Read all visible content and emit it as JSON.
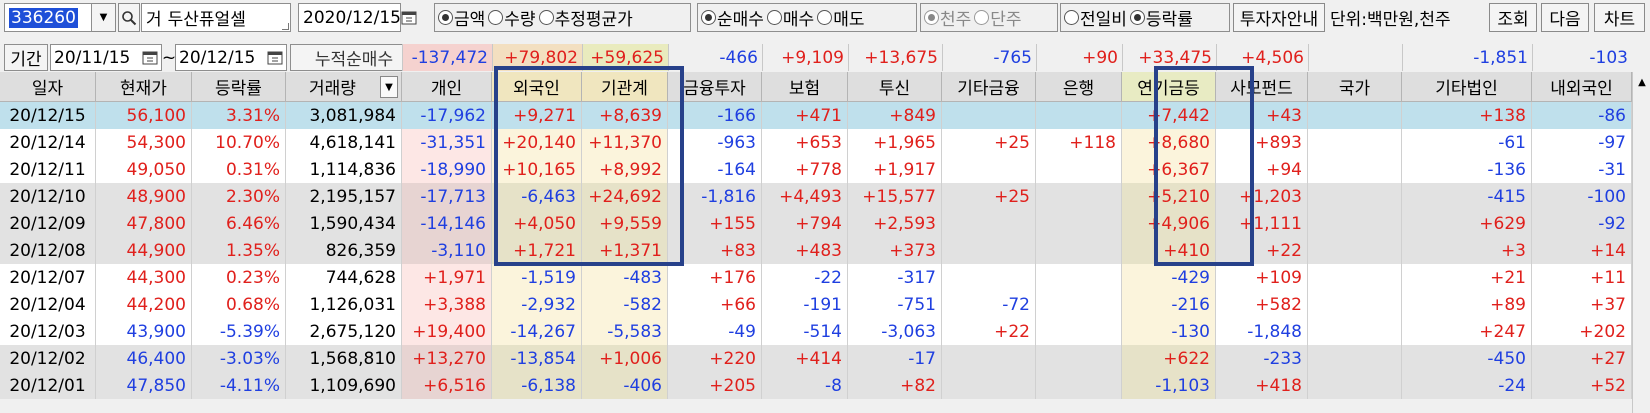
{
  "toolbar": {
    "stock_code": "336260",
    "stock_name_prefix": "거",
    "stock_name": "두산퓨얼셀",
    "date": "2020/12/15",
    "value_type": [
      {
        "label": "금액",
        "selected": true
      },
      {
        "label": "수량",
        "selected": false
      },
      {
        "label": "추정평균가",
        "selected": false
      }
    ],
    "trade_type": [
      {
        "label": "순매수",
        "selected": true
      },
      {
        "label": "매수",
        "selected": false
      },
      {
        "label": "매도",
        "selected": false
      }
    ],
    "unit_type": [
      {
        "label": "천주",
        "selected": true
      },
      {
        "label": "단주",
        "selected": false
      }
    ],
    "compare_type": [
      {
        "label": "전일비",
        "selected": false
      },
      {
        "label": "등락률",
        "selected": true
      }
    ],
    "investor_guide_label": "투자자안내",
    "unit_label": "단위:백만원,천주",
    "query_label": "조회",
    "next_label": "다음",
    "chart_label": "차트",
    "search_icon": "magnifier-icon",
    "dropdown_icon": "triangle-down-icon",
    "calendar_icon": "calendar-icon"
  },
  "period": {
    "label": "기간",
    "start": "20/11/15",
    "separator": "~",
    "end": "20/12/15",
    "cumulative_label": "누적순매수"
  },
  "cumulative": [
    {
      "value": "-137,472",
      "sign": "neg",
      "bg": "#f5d2cf"
    },
    {
      "value": "+79,802",
      "sign": "pos",
      "bg": "#f3dfc0"
    },
    {
      "value": "+59,625",
      "sign": "pos",
      "bg": "#e9ebbe"
    },
    {
      "value": "-466",
      "sign": "neg",
      "bg": ""
    },
    {
      "value": "+9,109",
      "sign": "pos",
      "bg": ""
    },
    {
      "value": "+13,675",
      "sign": "pos",
      "bg": ""
    },
    {
      "value": "-765",
      "sign": "neg",
      "bg": ""
    },
    {
      "value": "+90",
      "sign": "pos",
      "bg": ""
    },
    {
      "value": "+33,475",
      "sign": "pos",
      "bg": ""
    },
    {
      "value": "+4,506",
      "sign": "pos",
      "bg": ""
    },
    {
      "value": "",
      "sign": "",
      "bg": ""
    },
    {
      "value": "-1,851",
      "sign": "neg",
      "bg": ""
    },
    {
      "value": "-103",
      "sign": "neg",
      "bg": ""
    }
  ],
  "columns": [
    "일자",
    "현재가",
    "등락률",
    "거래량",
    "개인",
    "외국인",
    "기관계",
    "금융투자",
    "보험",
    "투신",
    "기타금융",
    "은행",
    "연기금등",
    "사모펀드",
    "국가",
    "기타법인",
    "내외국인"
  ],
  "colors": {
    "positive": "#e0201c",
    "negative": "#1f3fe0",
    "selected_row": "#bfe0ec",
    "gray_row": "#e2e2e2",
    "highlight_border": "#27418a"
  },
  "rows": [
    {
      "group": "sel",
      "cells": [
        "20/12/15",
        "56,100",
        "3.31%",
        "3,081,984",
        "-17,962",
        "+9,271",
        "+8,639",
        "-166",
        "+471",
        "+849",
        "",
        "",
        "+7,442",
        "+43",
        "",
        "+138",
        "-86"
      ]
    },
    {
      "group": "white",
      "cells": [
        "20/12/14",
        "54,300",
        "10.70%",
        "4,618,141",
        "-31,351",
        "+20,140",
        "+11,370",
        "-963",
        "+653",
        "+1,965",
        "+25",
        "+118",
        "+8,680",
        "+893",
        "",
        "-61",
        "-97"
      ]
    },
    {
      "group": "white",
      "cells": [
        "20/12/11",
        "49,050",
        "0.31%",
        "1,114,836",
        "-18,990",
        "+10,165",
        "+8,992",
        "-164",
        "+778",
        "+1,917",
        "",
        "",
        "+6,367",
        "+94",
        "",
        "-136",
        "-31"
      ]
    },
    {
      "group": "gray",
      "cells": [
        "20/12/10",
        "48,900",
        "2.30%",
        "2,195,157",
        "-17,713",
        "-6,463",
        "+24,692",
        "-1,816",
        "+4,493",
        "+15,577",
        "+25",
        "",
        "+5,210",
        "+1,203",
        "",
        "-415",
        "-100"
      ]
    },
    {
      "group": "gray",
      "cells": [
        "20/12/09",
        "47,800",
        "6.46%",
        "1,590,434",
        "-14,146",
        "+4,050",
        "+9,559",
        "+155",
        "+794",
        "+2,593",
        "",
        "",
        "+4,906",
        "+1,111",
        "",
        "+629",
        "-92"
      ]
    },
    {
      "group": "gray",
      "cells": [
        "20/12/08",
        "44,900",
        "1.35%",
        "826,359",
        "-3,110",
        "+1,721",
        "+1,371",
        "+83",
        "+483",
        "+373",
        "",
        "",
        "+410",
        "+22",
        "",
        "+3",
        "+14"
      ]
    },
    {
      "group": "white",
      "cells": [
        "20/12/07",
        "44,300",
        "0.23%",
        "744,628",
        "+1,971",
        "-1,519",
        "-483",
        "+176",
        "-22",
        "-317",
        "",
        "",
        "-429",
        "+109",
        "",
        "+21",
        "+11"
      ]
    },
    {
      "group": "white",
      "cells": [
        "20/12/04",
        "44,200",
        "0.68%",
        "1,126,031",
        "+3,388",
        "-2,932",
        "-582",
        "+66",
        "-191",
        "-751",
        "-72",
        "",
        "-216",
        "+582",
        "",
        "+89",
        "+37"
      ]
    },
    {
      "group": "white",
      "cells": [
        "20/12/03",
        "43,900",
        "-5.39%",
        "2,675,120",
        "+19,400",
        "-14,267",
        "-5,583",
        "-49",
        "-514",
        "-3,063",
        "+22",
        "",
        "-130",
        "-1,848",
        "",
        "+247",
        "+202"
      ]
    },
    {
      "group": "gray",
      "cells": [
        "20/12/02",
        "46,400",
        "-3.03%",
        "1,568,810",
        "+13,270",
        "-13,854",
        "+1,006",
        "+220",
        "+414",
        "-17",
        "",
        "",
        "+622",
        "-233",
        "",
        "-450",
        "+27"
      ]
    },
    {
      "group": "gray",
      "cells": [
        "20/12/01",
        "47,850",
        "-4.11%",
        "1,109,690",
        "+6,516",
        "-6,138",
        "-406",
        "+205",
        "-8",
        "+82",
        "",
        "",
        "-1,103",
        "+418",
        "",
        "-24",
        "+52"
      ]
    }
  ]
}
